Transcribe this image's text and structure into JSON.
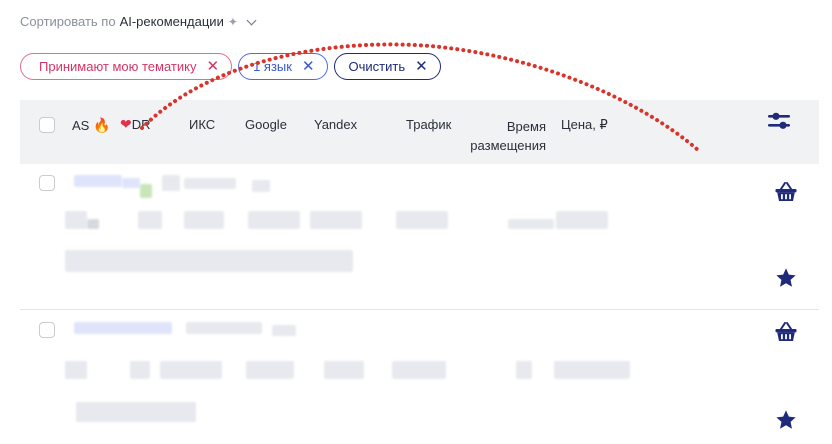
{
  "sort": {
    "prefix": "Сортировать по",
    "value": "AI-рекомендации",
    "sparkle": "✦"
  },
  "chips": [
    {
      "label": "Принимают мою тематику",
      "remove": "✕"
    },
    {
      "label": "1 язык",
      "remove": "✕"
    },
    {
      "label": "Очистить",
      "remove": "✕"
    }
  ],
  "table": {
    "headers": {
      "as": "AS",
      "dr": "DR",
      "iks": "ИКС",
      "google": "Google",
      "yandex": "Yandex",
      "traffic": "Трафик",
      "time_line1": "Время",
      "time_line2": "размещения",
      "price": "Цена, ₽"
    }
  },
  "icons": {
    "filters": "sliders-icon",
    "basket": "basket-icon",
    "favorite": "star-icon",
    "as_badge": "flame-icon",
    "dr_badge": "heart-icon"
  },
  "colors": {
    "accent_dark": "#1f2a7a",
    "chip_pink": "#d63465",
    "chip_blue": "#3a58cf",
    "annotation": "#d9342b"
  }
}
